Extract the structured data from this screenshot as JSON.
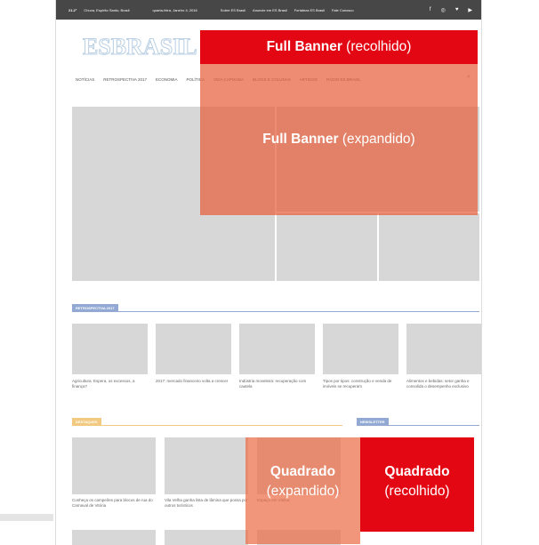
{
  "topbar": {
    "weather": "21.2°",
    "location": "Chuva, Espírito Santo, Brasil",
    "date": "quarta-feira, Janeiro 4, 2016",
    "links": [
      "Sobre ES Brasil",
      "Anuncie em ES Brasil",
      "Fortaleza ES Brasil",
      "Fale Conosco"
    ],
    "social": [
      "f-icon",
      "instagram-icon",
      "twitter-icon",
      "youtube-icon"
    ]
  },
  "logo": "ESBRASIL",
  "nav": {
    "items": [
      "NOTÍCIAS",
      "RETROSPECTIVA 2017",
      "ECONOMIA",
      "POLÍTICA",
      "VIDA CAPIXABA",
      "BLOGS E COLUNAS",
      "ARTIGOS",
      "RÁDIO ES BRASIL"
    ]
  },
  "sections": {
    "retro": "RETROSPECTIVA 2017",
    "destaques": "DESTAQUES",
    "news": "NEWSLETTER"
  },
  "retro_captions": [
    "Agricultura: Espera, os excessos, a finança?",
    "2017: mercado financeiro volta a crescer",
    "Indústria moveleira: recuperação com cautela",
    "Tipos por tipos: construção e venda de imóveis se recuperam",
    "Alimentos e bebidas: setor ganha e consolida o desempenho exclusivo"
  ],
  "dest_captions": [
    "Conheça os campeões para blocos de rua do Carnaval de Vitória",
    "Vila Velha ganha lista de lâmina que possa por outros turísticos",
    "Espaço em Vitória"
  ],
  "overlays": {
    "full_collapsed_bold": "Full Banner",
    "full_collapsed_rest": "(recolhido)",
    "full_expanded_bold": "Full Banner",
    "full_expanded_rest": "(expandido)",
    "square_expanded_bold": "Quadrado",
    "square_expanded_rest": "(expandido)",
    "square_collapsed_bold": "Quadrado",
    "square_collapsed_rest": "(recolhido)"
  },
  "colors": {
    "red": "#e30613",
    "orange_overlay": "#e65f3c",
    "blue_section": "#92a9d3",
    "yellow_section": "#f1c981"
  }
}
